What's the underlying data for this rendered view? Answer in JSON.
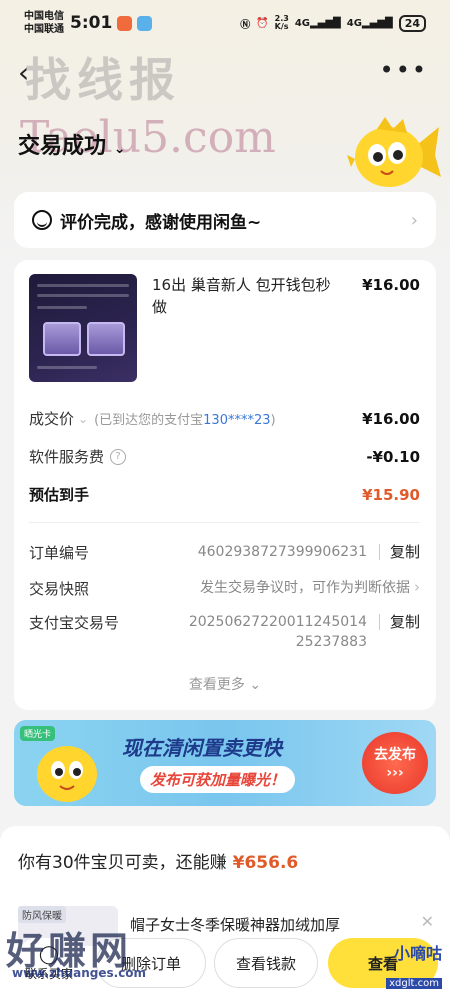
{
  "status": {
    "carrier1": "中国电信",
    "carrier2": "中国联通",
    "time": "5:01",
    "net_speed": "2.3\nK/s",
    "battery": "24"
  },
  "watermark": {
    "top": "找线报",
    "top_url": "Taolu5.com",
    "bottom": "好赚网",
    "bottom_url": "www.zhuanges.com",
    "right": "小嘀咕",
    "right_url": "xdglt.com"
  },
  "header": {
    "back": "‹",
    "more": "•••",
    "title": "交易成功"
  },
  "review": {
    "text": "评价完成，感谢使用闲鱼~"
  },
  "product": {
    "title": "16出 巢音新人 包开钱包秒做",
    "price": "¥16.00"
  },
  "amounts": {
    "deal_label": "成交价",
    "deal_note_prefix": "(已到达您的支付宝",
    "deal_account": "130****23",
    "deal_note_suffix": ")",
    "deal_value": "¥16.00",
    "fee_label": "软件服务费",
    "fee_value": "-¥0.10",
    "net_label": "预估到手",
    "net_value": "¥15.90"
  },
  "info": {
    "order_label": "订单编号",
    "order_value": "4602938727399906231",
    "order_action": "复制",
    "snapshot_label": "交易快照",
    "snapshot_value": "发生交易争议时，可作为判断依据",
    "alipay_label": "支付宝交易号",
    "alipay_value": "20250627220011245014 25237883",
    "alipay_action": "复制",
    "see_more": "查看更多"
  },
  "banner": {
    "tag": "晒光卡",
    "title": "现在清闲置卖更快",
    "subtitle": "发布可获加量曝光！",
    "button": "去发布"
  },
  "bottom": {
    "sell_text": "你有30件宝贝可卖，还能赚",
    "sell_price": "¥656.6",
    "mini_tag": "防风保暖",
    "mini_title": "帽子女士冬季保暖神器加绒加厚",
    "contact": "联系买家",
    "delete": "删除订单",
    "wallet": "查看钱款",
    "view": "查看"
  },
  "colors": {
    "accent_orange": "#e05a2a",
    "link_blue": "#3a78d8",
    "primary_yellow": "#ffe03a"
  }
}
